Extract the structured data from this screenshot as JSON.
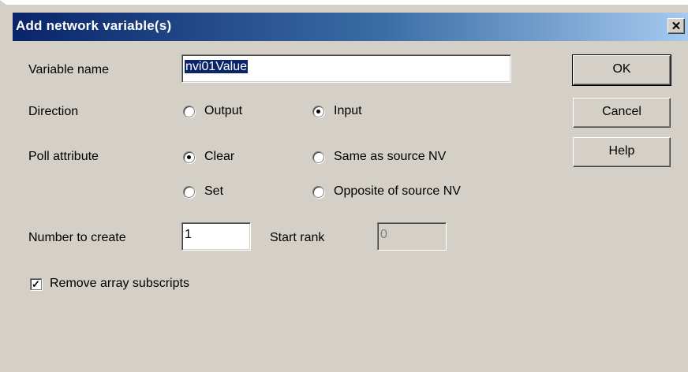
{
  "dialog": {
    "title": "Add network variable(s)",
    "close_glyph": "✕"
  },
  "variable_name": {
    "label": "Variable name",
    "value": "nvi01Value"
  },
  "direction": {
    "label": "Direction",
    "options": [
      {
        "label": "Output",
        "selected": false
      },
      {
        "label": "Input",
        "selected": true
      }
    ]
  },
  "poll_attribute": {
    "label": "Poll attribute",
    "options": [
      {
        "label": "Clear",
        "selected": true
      },
      {
        "label": "Same as source NV",
        "selected": false
      },
      {
        "label": "Set",
        "selected": false
      },
      {
        "label": "Opposite of source NV",
        "selected": false
      }
    ]
  },
  "number_to_create": {
    "label": "Number to create",
    "value": "1"
  },
  "start_rank": {
    "label": "Start rank",
    "value": "0",
    "enabled": false
  },
  "remove_subscripts": {
    "label": "Remove array subscripts",
    "checked": true
  },
  "buttons": {
    "ok": "OK",
    "cancel": "Cancel",
    "help": "Help"
  },
  "colors": {
    "titlebar_start": "#0a246a",
    "titlebar_end": "#a6caf0",
    "face": "#d4d0c8"
  }
}
